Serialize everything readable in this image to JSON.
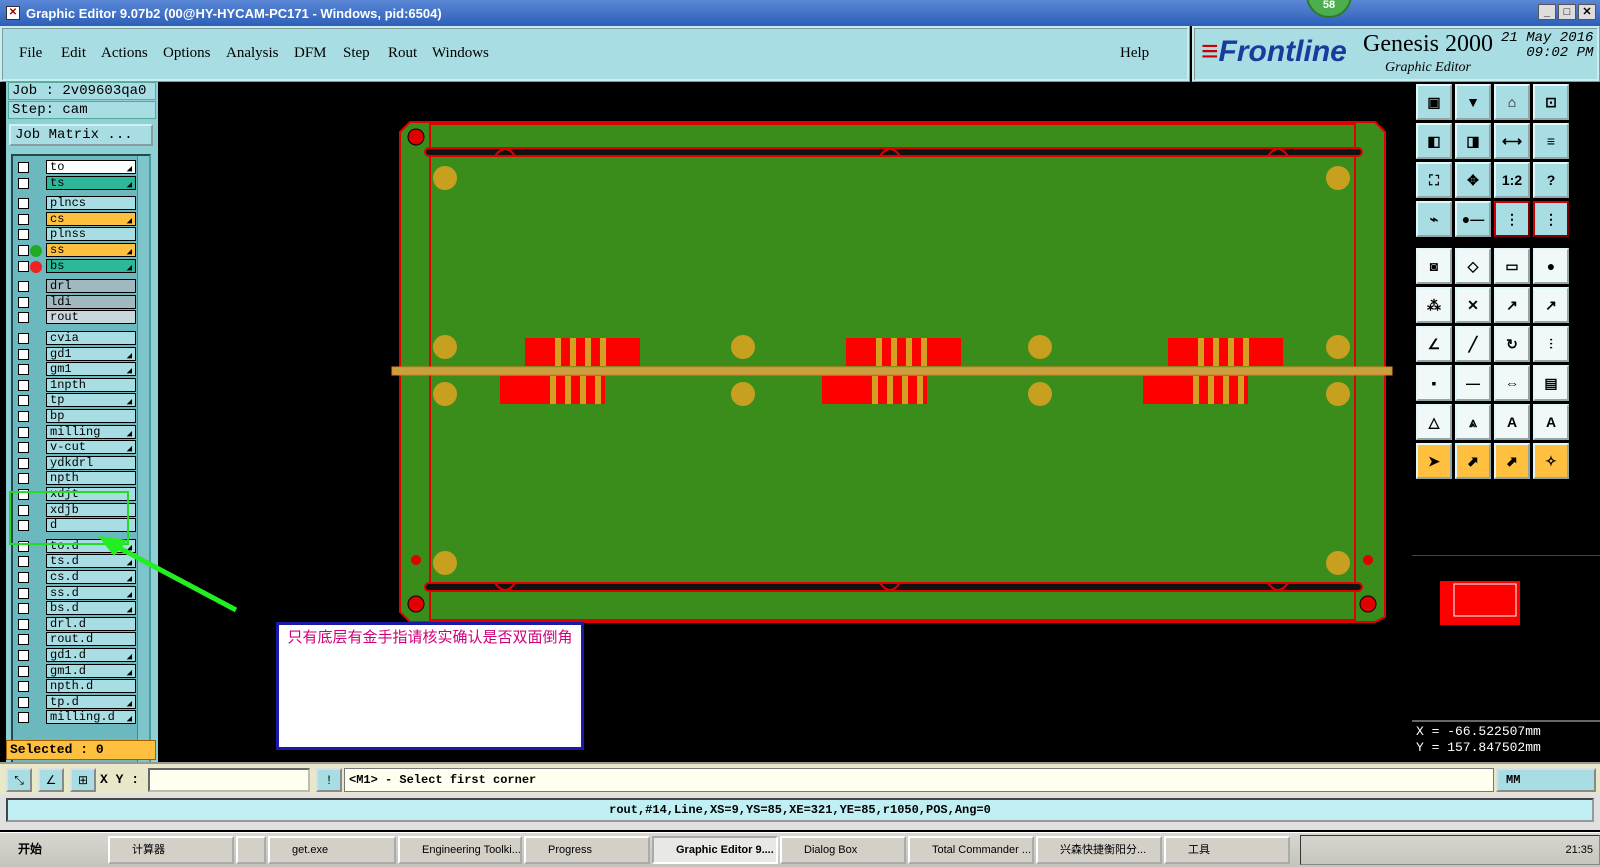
{
  "window": {
    "title": "Graphic Editor 9.07b2 (00@HY-HYCAM-PC171 - Windows, pid:6504)",
    "badge": "58"
  },
  "menu": {
    "items": [
      "File",
      "Edit",
      "Actions",
      "Options",
      "Analysis",
      "DFM",
      "Step",
      "Rout",
      "Windows"
    ],
    "help": "Help"
  },
  "brand": {
    "frontline": "Frontline",
    "product": "Genesis 2000",
    "sub": "Graphic Editor",
    "date": "21 May 2016",
    "time": "09:02 PM"
  },
  "job": {
    "job": "Job : 2v09603qa0",
    "step": "Step: cam",
    "matrix": "Job Matrix ..."
  },
  "layers": [
    {
      "name": "to",
      "color": "#ffffff",
      "arrow": true
    },
    {
      "name": "ts",
      "color": "#2db89a",
      "arrow": true
    },
    {
      "name": "plncs",
      "color": "#a8dde4",
      "arrow": false
    },
    {
      "name": "cs",
      "color": "#ffc040",
      "arrow": true
    },
    {
      "name": "plnss",
      "color": "#a8dde4",
      "arrow": false
    },
    {
      "name": "ss",
      "color": "#ffc040",
      "arrow": true,
      "dot": "#22aa22"
    },
    {
      "name": "bs",
      "color": "#2db89a",
      "arrow": true,
      "dot": "#ee2222"
    },
    {
      "name": "drl",
      "color": "#a0b8c0",
      "arrow": false
    },
    {
      "name": "ldi",
      "color": "#a0b8c0",
      "arrow": false
    },
    {
      "name": "rout",
      "color": "#c8d8dc",
      "arrow": false
    },
    {
      "name": "cvia",
      "color": "#a8dde4",
      "arrow": false
    },
    {
      "name": "gd1",
      "color": "#a8dde4",
      "arrow": true
    },
    {
      "name": "gm1",
      "color": "#a8dde4",
      "arrow": true
    },
    {
      "name": "1npth",
      "color": "#a8dde4",
      "arrow": false
    },
    {
      "name": "tp",
      "color": "#a8dde4",
      "arrow": true
    },
    {
      "name": "bp",
      "color": "#a8dde4",
      "arrow": false
    },
    {
      "name": "milling",
      "color": "#a8dde4",
      "arrow": true
    },
    {
      "name": "v-cut",
      "color": "#a8dde4",
      "arrow": true
    },
    {
      "name": "ydkdrl",
      "color": "#a8dde4",
      "arrow": false
    },
    {
      "name": "npth",
      "color": "#a8dde4",
      "arrow": false
    },
    {
      "name": "xdjt",
      "color": "#a8dde4",
      "arrow": false
    },
    {
      "name": "xdjb",
      "color": "#a8dde4",
      "arrow": false
    },
    {
      "name": "d",
      "color": "#a8dde4",
      "arrow": false
    },
    {
      "name": "to.d",
      "color": "#a8dde4",
      "arrow": true
    },
    {
      "name": "ts.d",
      "color": "#a8dde4",
      "arrow": true
    },
    {
      "name": "cs.d",
      "color": "#a8dde4",
      "arrow": true
    },
    {
      "name": "ss.d",
      "color": "#a8dde4",
      "arrow": true
    },
    {
      "name": "bs.d",
      "color": "#a8dde4",
      "arrow": true
    },
    {
      "name": "drl.d",
      "color": "#a8dde4",
      "arrow": false
    },
    {
      "name": "rout.d",
      "color": "#a8dde4",
      "arrow": false
    },
    {
      "name": "gd1.d",
      "color": "#a8dde4",
      "arrow": true
    },
    {
      "name": "gm1.d",
      "color": "#a8dde4",
      "arrow": true
    },
    {
      "name": "npth.d",
      "color": "#a8dde4",
      "arrow": false
    },
    {
      "name": "tp.d",
      "color": "#a8dde4",
      "arrow": true
    },
    {
      "name": "milling.d",
      "color": "#a8dde4",
      "arrow": true
    }
  ],
  "selected": "Selected : 0",
  "note": {
    "text": "只有底层有金手指请核实确认是否双面倒角"
  },
  "coords": {
    "x": "X = -66.522507mm",
    "y": "Y = 157.847502mm"
  },
  "cmd": {
    "xy_label": "X Y :",
    "xy_value": "",
    "message": "<M1> - Select first corner",
    "units": "MM"
  },
  "status": {
    "text": "rout,#14,Line,XS=9,YS=85,XE=321,YE=85,r1050,POS,Ang=0"
  },
  "taskbar": {
    "start": "开始",
    "items": [
      "计算器",
      "",
      "get.exe",
      "Engineering Toolki...",
      "Progress",
      "Graphic Editor 9....",
      "Dialog Box",
      "Total Commander ...",
      "兴森快捷衡阳分...",
      "工具"
    ],
    "clock": "21:35"
  }
}
